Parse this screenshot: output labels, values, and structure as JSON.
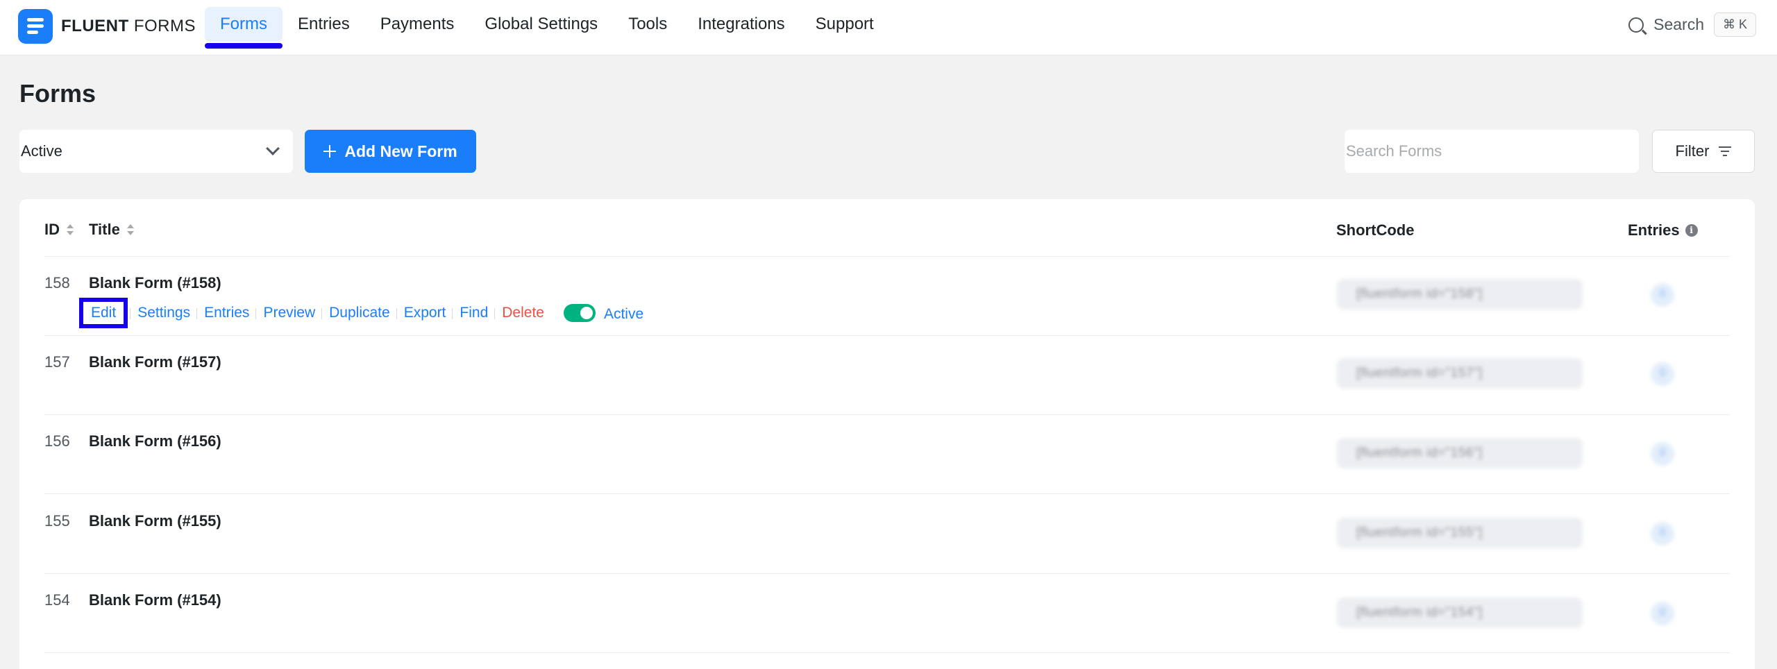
{
  "app": {
    "brand_bold": "FLUENT",
    "brand_light": " FORMS",
    "accent_color": "#1a7efb"
  },
  "nav": {
    "items": [
      {
        "label": "Forms",
        "active": true
      },
      {
        "label": "Entries"
      },
      {
        "label": "Payments"
      },
      {
        "label": "Global Settings"
      },
      {
        "label": "Tools"
      },
      {
        "label": "Integrations"
      },
      {
        "label": "Support"
      }
    ],
    "search_label": "Search",
    "search_shortcut": "⌘ K"
  },
  "page": {
    "title": "Forms",
    "status_filter": "Active",
    "add_button": "Add New Form",
    "search_placeholder": "Search Forms",
    "filter_button": "Filter"
  },
  "table": {
    "columns": {
      "id": "ID",
      "title": "Title",
      "shortcode": "ShortCode",
      "entries": "Entries"
    },
    "rows": [
      {
        "id": "158",
        "title": "Blank Form (#158)",
        "shortcode": "[fluentform id=\"158\"]",
        "entries": "0"
      },
      {
        "id": "157",
        "title": "Blank Form (#157)",
        "shortcode": "[fluentform id=\"157\"]",
        "entries": "0"
      },
      {
        "id": "156",
        "title": "Blank Form (#156)",
        "shortcode": "[fluentform id=\"156\"]",
        "entries": "0"
      },
      {
        "id": "155",
        "title": "Blank Form (#155)",
        "shortcode": "[fluentform id=\"155\"]",
        "entries": "0"
      },
      {
        "id": "154",
        "title": "Blank Form (#154)",
        "shortcode": "[fluentform id=\"154\"]",
        "entries": "0"
      }
    ],
    "row_actions": {
      "edit": "Edit",
      "settings": "Settings",
      "entries": "Entries",
      "preview": "Preview",
      "duplicate": "Duplicate",
      "export": "Export",
      "find": "Find",
      "delete": "Delete",
      "toggle_label": "Active",
      "toggle_on": true
    }
  }
}
